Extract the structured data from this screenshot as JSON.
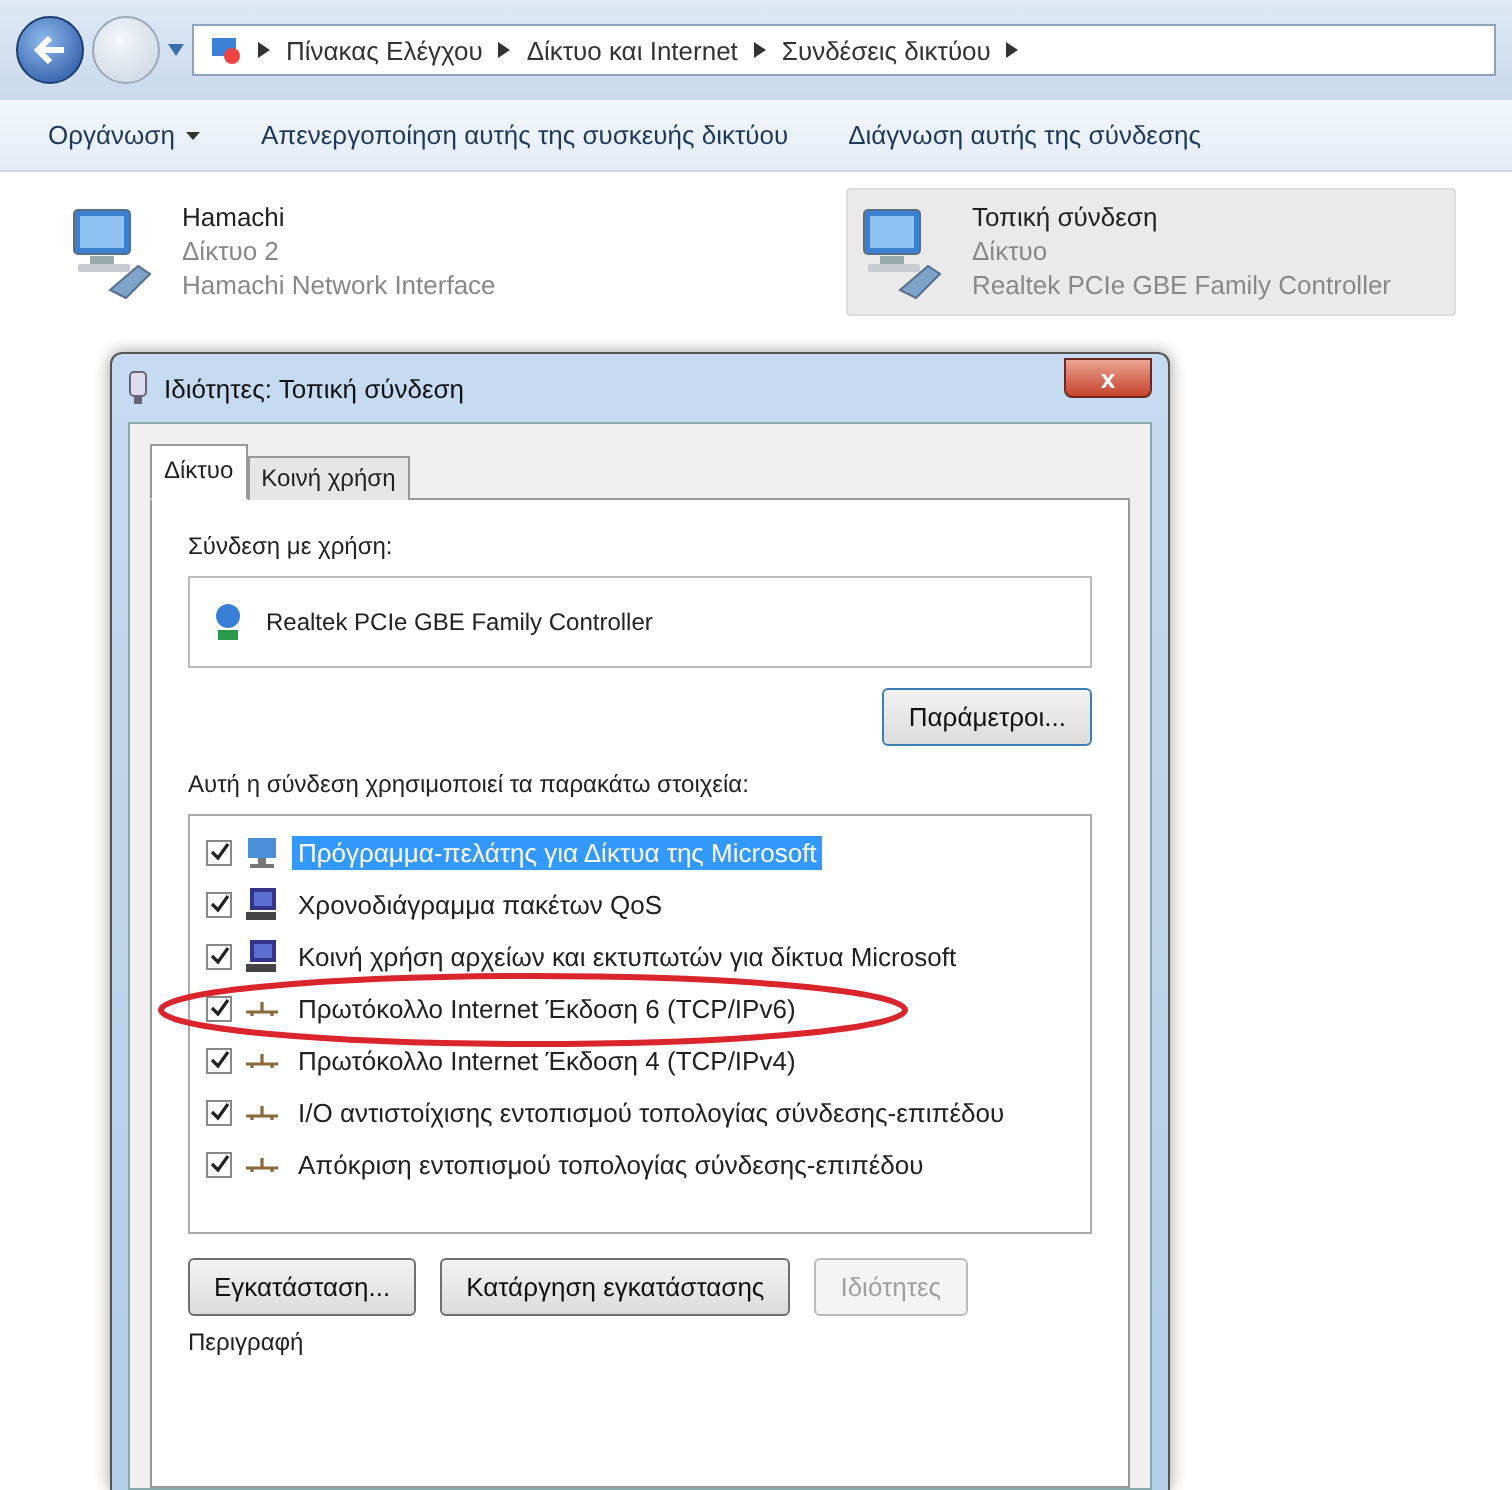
{
  "address_bar": {
    "crumbs": [
      "Πίνακας Ελέγχου",
      "Δίκτυο και Internet",
      "Συνδέσεις δικτύου"
    ]
  },
  "toolbar": {
    "items": [
      {
        "label": "Οργάνωση",
        "dropdown": true
      },
      {
        "label": "Απενεργοποίηση αυτής της συσκευής δικτύου",
        "dropdown": false
      },
      {
        "label": "Διάγνωση αυτής της σύνδεσης",
        "dropdown": false
      }
    ]
  },
  "connections": [
    {
      "name": "Hamachi",
      "network": "Δίκτυο  2",
      "adapter": "Hamachi Network Interface",
      "selected": false
    },
    {
      "name": "Τοπική σύνδεση",
      "network": "Δίκτυο",
      "adapter": "Realtek PCIe GBE Family Controller",
      "selected": true
    }
  ],
  "dialog": {
    "title": "Ιδιότητες: Τοπική σύνδεση",
    "close": "x",
    "tabs": [
      {
        "label": "Δίκτυο",
        "selected": true
      },
      {
        "label": "Κοινή χρήση",
        "selected": false
      }
    ],
    "connect_using_label": "Σύνδεση με χρήση:",
    "adapter": "Realtek PCIe GBE Family Controller",
    "configure_button": "Παράμετροι...",
    "items_label": "Αυτή η σύνδεση χρησιμοποιεί τα παρακάτω στοιχεία:",
    "items": [
      {
        "kind": "client",
        "label": "Πρόγραμμα-πελάτης για Δίκτυα της Microsoft",
        "checked": true,
        "selected": true
      },
      {
        "kind": "service",
        "label": "Χρονοδιάγραμμα πακέτων QoS",
        "checked": true,
        "selected": false
      },
      {
        "kind": "service",
        "label": "Κοινή χρήση αρχείων και εκτυπωτών για δίκτυα Microsoft",
        "checked": true,
        "selected": false
      },
      {
        "kind": "protocol",
        "label": "Πρωτόκολλο Internet Έκδοση 6 (TCP/IPv6)",
        "checked": true,
        "selected": false
      },
      {
        "kind": "protocol",
        "label": "Πρωτόκολλο Internet Έκδοση 4 (TCP/IPv4)",
        "checked": true,
        "selected": false
      },
      {
        "kind": "protocol",
        "label": "I/O αντιστοίχισης εντοπισμού τοπολογίας σύνδεσης-επιπέδου",
        "checked": true,
        "selected": false
      },
      {
        "kind": "protocol",
        "label": "Απόκριση εντοπισμού τοπολογίας σύνδεσης-επιπέδου",
        "checked": true,
        "selected": false
      }
    ],
    "buttons": [
      {
        "label": "Εγκατάσταση...",
        "disabled": false
      },
      {
        "label": "Κατάργηση εγκατάστασης",
        "disabled": false
      },
      {
        "label": "Ιδιότητες",
        "disabled": true
      }
    ],
    "description_label": "Περιγραφή"
  }
}
